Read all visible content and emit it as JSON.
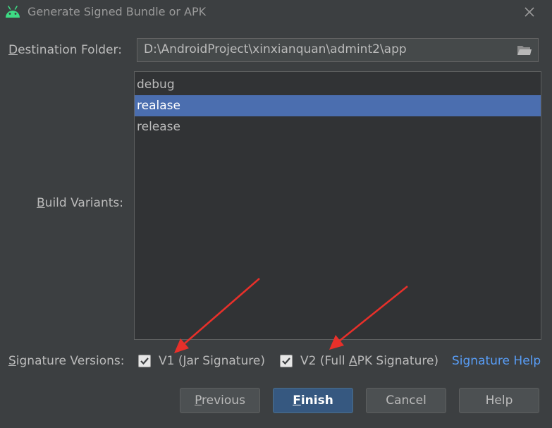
{
  "window": {
    "title": "Generate Signed Bundle or APK",
    "icon": "android-icon",
    "close_icon": "close-icon"
  },
  "destination": {
    "label_mnemonic": "D",
    "label_rest": "estination Folder:",
    "path": "D:\\AndroidProject\\xinxianquan\\admint2\\app",
    "browse_icon": "folder-icon"
  },
  "build_variants": {
    "label_mnemonic": "B",
    "label_rest": "uild Variants:",
    "items": [
      "debug",
      "realase",
      "release"
    ],
    "selected": "realase"
  },
  "signature": {
    "label_mnemonic": "S",
    "label_rest": "ignature Versions:",
    "v1": {
      "checked": true,
      "pre": "V1 (",
      "mnemonic": "J",
      "post": "ar Signature)"
    },
    "v2": {
      "checked": true,
      "pre": "V2 (Full ",
      "mnemonic": "A",
      "post": "PK Signature)"
    },
    "help_link": "Signature Help"
  },
  "buttons": {
    "previous_mnemonic": "P",
    "previous_rest": "revious",
    "finish_mnemonic": "F",
    "finish_rest": "inish",
    "cancel": "Cancel",
    "help": "Help"
  },
  "colors": {
    "background": "#3c3f41",
    "selection": "#4b6eaf",
    "link": "#589df6",
    "default_button": "#365880",
    "annotation_arrow": "#e8302a",
    "android_green": "#3ddc84"
  }
}
